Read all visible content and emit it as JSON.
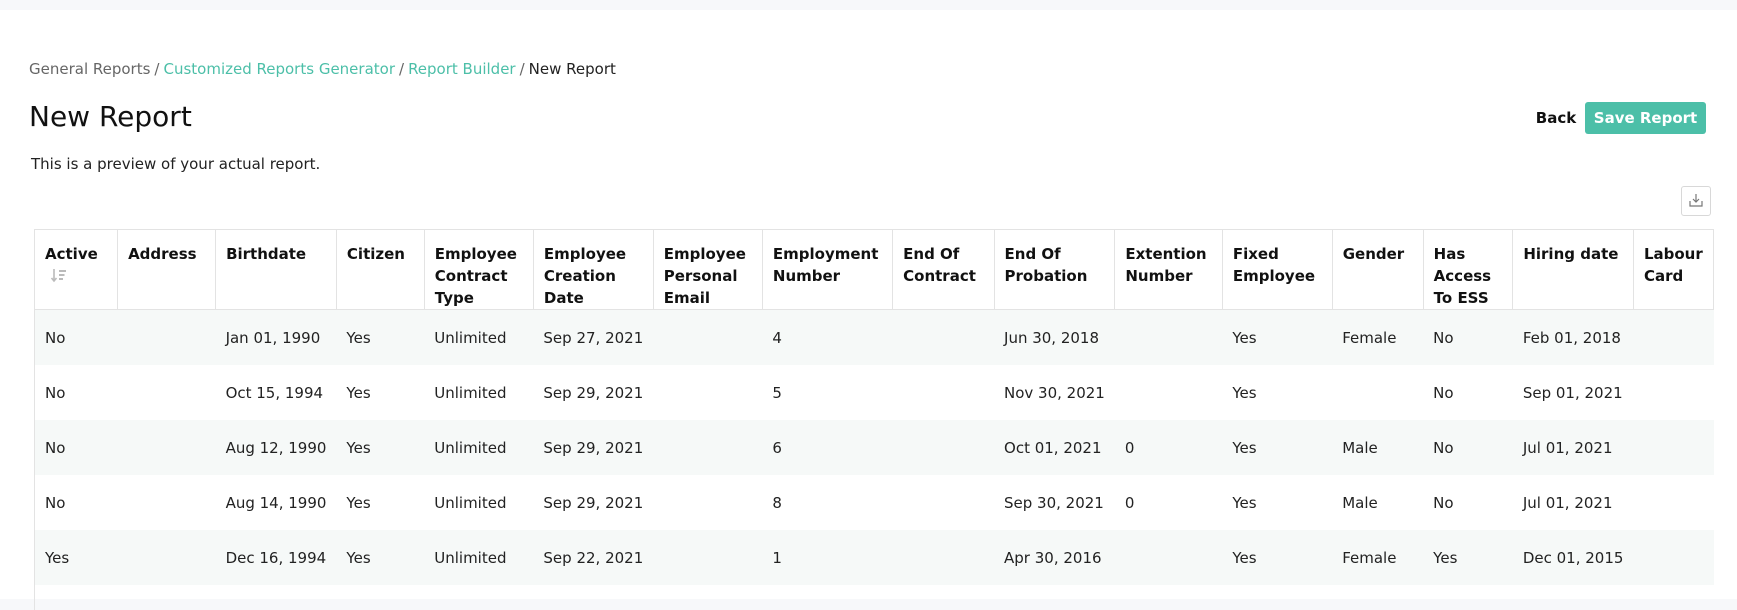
{
  "breadcrumb": {
    "items": [
      {
        "label": "General Reports",
        "type": "plain"
      },
      {
        "label": "Customized Reports Generator",
        "type": "link"
      },
      {
        "label": "Report Builder",
        "type": "link"
      },
      {
        "label": "New Report",
        "type": "current"
      }
    ],
    "separator": "/"
  },
  "header": {
    "title": "New Report",
    "subtitle": "This is a preview of your actual report.",
    "back_label": "Back",
    "save_label": "Save Report"
  },
  "toolbar": {
    "export_icon": "download-icon"
  },
  "colors": {
    "accent": "#4cbfa8",
    "row_alt": "#f6f9f8"
  },
  "table": {
    "columns": [
      "Active",
      "Address",
      "Birthdate",
      "Citizen",
      "Employee Contract Type",
      "Employee Creation Date",
      "Employee Personal Email",
      "Employment Number",
      "End Of Contract",
      "End Of Probation",
      "Extention Number",
      "Fixed Employee",
      "Gender",
      "Has Access To ESS",
      "Hiring date",
      "Labour Card"
    ],
    "sorted_column_icon": "sort-descending-icon",
    "rows": [
      [
        "No",
        "",
        "Jan 01, 1990",
        "Yes",
        "Unlimited",
        "Sep 27, 2021",
        "",
        "4",
        "",
        "Jun 30, 2018",
        "",
        "Yes",
        "Female",
        "No",
        "Feb 01, 2018",
        ""
      ],
      [
        "No",
        "",
        "Oct 15, 1994",
        "Yes",
        "Unlimited",
        "Sep 29, 2021",
        "",
        "5",
        "",
        "Nov 30, 2021",
        "",
        "Yes",
        "",
        "No",
        "Sep 01, 2021",
        ""
      ],
      [
        "No",
        "",
        "Aug 12, 1990",
        "Yes",
        "Unlimited",
        "Sep 29, 2021",
        "",
        "6",
        "",
        "Oct 01, 2021",
        "0",
        "Yes",
        "Male",
        "No",
        "Jul 01, 2021",
        ""
      ],
      [
        "No",
        "",
        "Aug 14, 1990",
        "Yes",
        "Unlimited",
        "Sep 29, 2021",
        "",
        "8",
        "",
        "Sep 30, 2021",
        "0",
        "Yes",
        "Male",
        "No",
        "Jul 01, 2021",
        ""
      ],
      [
        "Yes",
        "",
        "Dec 16, 1994",
        "Yes",
        "Unlimited",
        "Sep 22, 2021",
        "",
        "1",
        "",
        "Apr 30, 2016",
        "",
        "Yes",
        "Female",
        "Yes",
        "Dec 01, 2015",
        ""
      ]
    ]
  }
}
